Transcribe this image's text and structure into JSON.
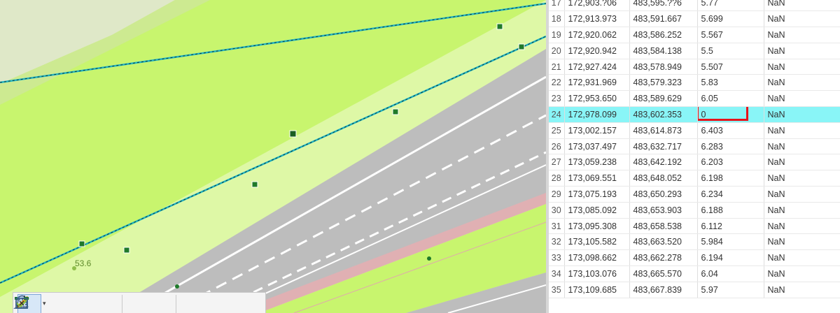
{
  "map": {
    "elevation_label": "53.6",
    "colors": {
      "grass": "#c8f56e",
      "shoulder": "#def8a6",
      "road": "#bdbdbd",
      "curb": "#e0b0b3",
      "edge_line": "#22b4c2"
    }
  },
  "toolbar": {
    "tools": [
      {
        "name": "reshape-tool-icon",
        "active": true
      },
      {
        "name": "add-vertex-icon"
      },
      {
        "name": "delete-vertex-icon"
      },
      {
        "name": "pencil-icon"
      },
      {
        "name": "select-vertices-icon"
      },
      {
        "name": "check-geometry-icon"
      },
      {
        "name": "finish-sketch-icon"
      },
      {
        "name": "clear-sketch-icon"
      }
    ]
  },
  "table": {
    "partial_top_row": {
      "row": "17",
      "x": "172,903.?06",
      "y": "483,595.??6",
      "z": "5.77",
      "m": "NaN"
    },
    "rows": [
      {
        "row": "18",
        "x": "172,913.973",
        "y": "483,591.667",
        "z": "5.699",
        "m": "NaN"
      },
      {
        "row": "19",
        "x": "172,920.062",
        "y": "483,586.252",
        "z": "5.567",
        "m": "NaN"
      },
      {
        "row": "20",
        "x": "172,920.942",
        "y": "483,584.138",
        "z": "5.5",
        "m": "NaN"
      },
      {
        "row": "21",
        "x": "172,927.424",
        "y": "483,578.949",
        "z": "5.507",
        "m": "NaN"
      },
      {
        "row": "22",
        "x": "172,931.969",
        "y": "483,579.323",
        "z": "5.83",
        "m": "NaN"
      },
      {
        "row": "23",
        "x": "172,953.650",
        "y": "483,589.629",
        "z": "6.05",
        "m": "NaN"
      },
      {
        "row": "24",
        "x": "172,978.099",
        "y": "483,602.353",
        "z": "0",
        "m": "NaN",
        "selected": true
      },
      {
        "row": "25",
        "x": "173,002.157",
        "y": "483,614.873",
        "z": "6.403",
        "m": "NaN"
      },
      {
        "row": "26",
        "x": "173,037.497",
        "y": "483,632.717",
        "z": "6.283",
        "m": "NaN"
      },
      {
        "row": "27",
        "x": "173,059.238",
        "y": "483,642.192",
        "z": "6.203",
        "m": "NaN"
      },
      {
        "row": "28",
        "x": "173,069.551",
        "y": "483,648.052",
        "z": "6.198",
        "m": "NaN"
      },
      {
        "row": "29",
        "x": "173,075.193",
        "y": "483,650.293",
        "z": "6.234",
        "m": "NaN"
      },
      {
        "row": "30",
        "x": "173,085.092",
        "y": "483,653.903",
        "z": "6.188",
        "m": "NaN"
      },
      {
        "row": "31",
        "x": "173,095.308",
        "y": "483,658.538",
        "z": "6.112",
        "m": "NaN"
      },
      {
        "row": "32",
        "x": "173,105.582",
        "y": "483,663.520",
        "z": "5.984",
        "m": "NaN"
      },
      {
        "row": "33",
        "x": "173,098.662",
        "y": "483,662.278",
        "z": "6.194",
        "m": "NaN"
      },
      {
        "row": "34",
        "x": "173,103.076",
        "y": "483,665.570",
        "z": "6.04",
        "m": "NaN"
      },
      {
        "row": "35",
        "x": "173,109.685",
        "y": "483,667.839",
        "z": "5.97",
        "m": "NaN"
      }
    ]
  }
}
